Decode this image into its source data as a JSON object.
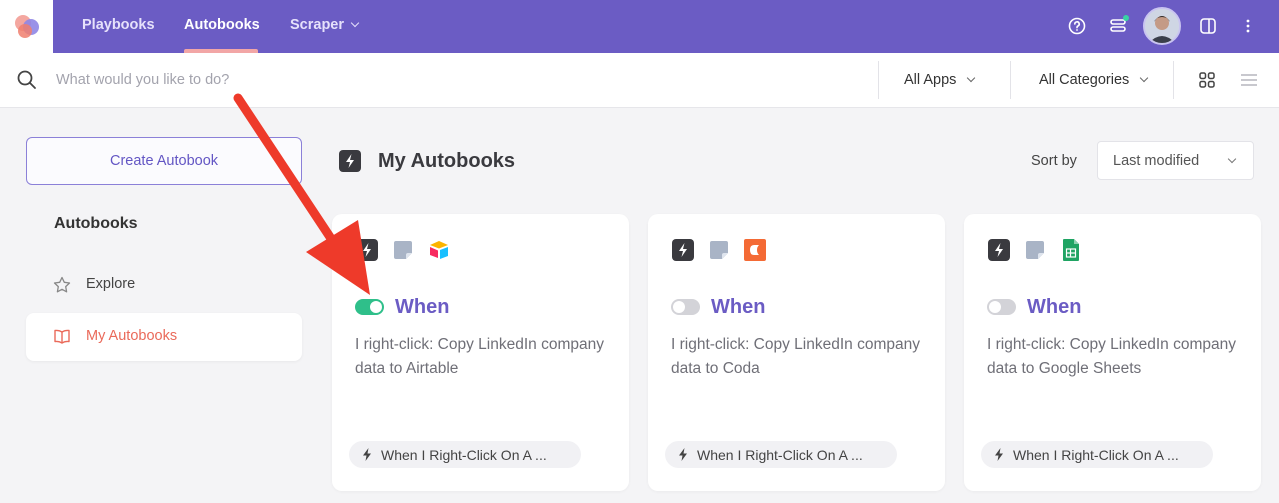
{
  "topbar": {
    "nav": [
      {
        "label": "Playbooks",
        "active": false
      },
      {
        "label": "Autobooks",
        "active": true
      },
      {
        "label": "Scraper",
        "active": false,
        "has_dropdown": true
      }
    ],
    "icons": [
      "help-icon",
      "list-status-icon",
      "avatar",
      "panel-toggle-icon",
      "more-vertical-icon"
    ],
    "brand_color": "#6b5cc4"
  },
  "search": {
    "placeholder": "What would you like to do?",
    "value": "",
    "apps_filter": "All Apps",
    "categories_filter": "All Categories",
    "view_modes": [
      "grid-view-icon",
      "list-view-icon"
    ]
  },
  "sidebar": {
    "create_label": "Create Autobook",
    "heading": "Autobooks",
    "items": [
      {
        "label": "Explore",
        "icon": "star-icon",
        "active": false
      },
      {
        "label": "My Autobooks",
        "icon": "book-icon",
        "active": true
      }
    ]
  },
  "main": {
    "title": "My Autobooks",
    "sort_label": "Sort by",
    "sort_value": "Last modified",
    "cards": [
      {
        "apps": [
          "bolt-icon",
          "note-icon",
          "airtable-icon"
        ],
        "enabled": true,
        "when": "When",
        "description": "I right-click: Copy LinkedIn company data to Airtable",
        "trigger": "When I Right-Click On A ..."
      },
      {
        "apps": [
          "bolt-icon",
          "note-icon",
          "coda-icon"
        ],
        "enabled": false,
        "when": "When",
        "description": "I right-click: Copy LinkedIn company data to Coda",
        "trigger": "When I Right-Click On A ..."
      },
      {
        "apps": [
          "bolt-icon",
          "note-icon",
          "google-sheets-icon"
        ],
        "enabled": false,
        "when": "When",
        "description": "I right-click: Copy LinkedIn company data to Google Sheets",
        "trigger": "When I Right-Click On A ..."
      }
    ]
  },
  "colors": {
    "accent": "#6b5cc4",
    "toggle_on": "#2fbf8a",
    "active_sidebar": "#ea6a5a",
    "annotation_arrow": "#ee3a2a"
  }
}
